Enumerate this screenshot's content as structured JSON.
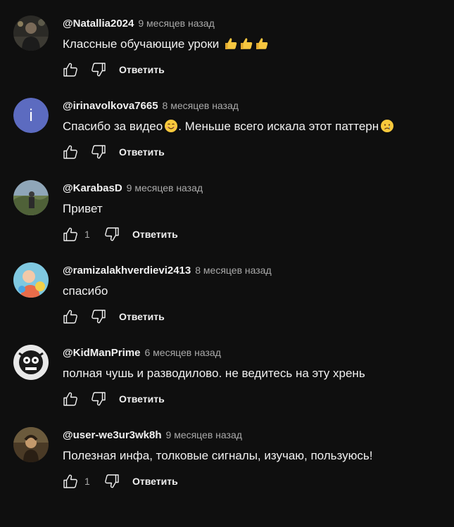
{
  "colors": {
    "background": "#0f0f0f",
    "primary_text": "#f1f1f1",
    "secondary_text": "#aaaaaa",
    "avatar_letter_bg": "#5c6bc0"
  },
  "comments": [
    {
      "author": "@Natallia2024",
      "time": "9 месяцев назад",
      "text": "Классные обучающие уроки",
      "emojis": [
        "thumbs-up",
        "thumbs-up",
        "thumbs-up"
      ],
      "likes": "",
      "reply_label": "Ответить"
    },
    {
      "author": "@irinavolkova7665",
      "avatar_letter": "i",
      "time": "8 месяцев назад",
      "text_before": "Спасибо за видео",
      "text_after": ". Меньше всего искала этот паттерн",
      "emojis": [
        "smiling-face",
        "crying-face"
      ],
      "likes": "",
      "reply_label": "Ответить"
    },
    {
      "author": "@KarabasD",
      "time": "9 месяцев назад",
      "text": "Привет",
      "likes": "1",
      "reply_label": "Ответить"
    },
    {
      "author": "@ramizalakhverdievi2413",
      "time": "8 месяцев назад",
      "text": "спасибо",
      "likes": "",
      "reply_label": "Ответить"
    },
    {
      "author": "@KidManPrime",
      "time": "6 месяцев назад",
      "text": "полная чушь и разводилово. не ведитесь на эту хрень",
      "likes": "",
      "reply_label": "Ответить"
    },
    {
      "author": "@user-we3ur3wk8h",
      "time": "9 месяцев назад",
      "text": "Полезная инфа, толковые сигналы, изучаю, пользуюсь!",
      "likes": "1",
      "reply_label": "Ответить"
    }
  ],
  "icons": {
    "like": "thumb-up-outline-icon",
    "dislike": "thumb-down-outline-icon"
  }
}
